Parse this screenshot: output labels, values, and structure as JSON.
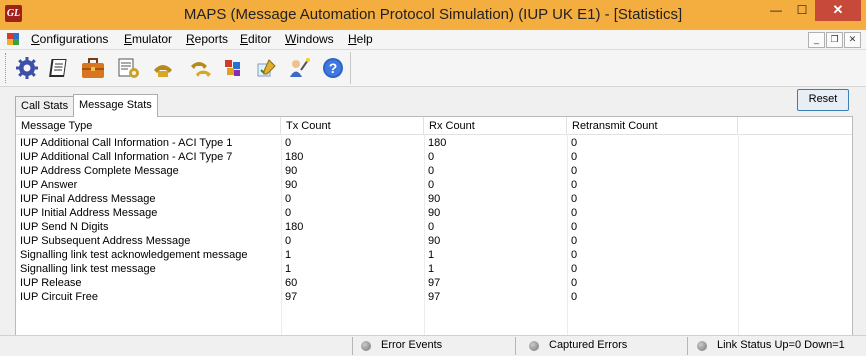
{
  "window": {
    "title": "MAPS (Message Automation Protocol Simulation)  (IUP UK E1) - [Statistics]",
    "icon_text": "GL",
    "minimize": "—",
    "maximize": "☐",
    "close": "✕"
  },
  "menu": {
    "items": [
      "Configurations",
      "Emulator",
      "Reports",
      "Editor",
      "Windows",
      "Help"
    ],
    "mdi_min": "_",
    "mdi_restore": "❐",
    "mdi_close": "✕"
  },
  "toolbar": {
    "icons": [
      "gear-icon",
      "notebook-icon",
      "briefcase-icon",
      "script-edit-icon",
      "phone-call-icon",
      "phone-transfer-icon",
      "color-blocks-icon",
      "pen-check-icon",
      "wizard-icon",
      "help-icon"
    ]
  },
  "tabs": [
    "Call Stats",
    "Message Stats"
  ],
  "active_tab": "Message Stats",
  "reset_label": "Reset",
  "table": {
    "columns": [
      "Message Type",
      "Tx Count",
      "Rx Count",
      "Retransmit Count"
    ],
    "rows": [
      [
        "IUP Additional Call Information - ACI Type 1",
        "0",
        "180",
        "0"
      ],
      [
        "IUP Additional Call Information - ACI Type 7",
        "180",
        "0",
        "0"
      ],
      [
        "IUP Address Complete Message",
        "90",
        "0",
        "0"
      ],
      [
        "IUP Answer",
        "90",
        "0",
        "0"
      ],
      [
        "IUP Final Address Message",
        "0",
        "90",
        "0"
      ],
      [
        "IUP Initial Address Message",
        "0",
        "90",
        "0"
      ],
      [
        "IUP Send N Digits",
        "180",
        "0",
        "0"
      ],
      [
        "IUP Subsequent Address Message",
        "0",
        "90",
        "0"
      ],
      [
        "Signalling link test acknowledgement message",
        "1",
        "1",
        "0"
      ],
      [
        "Signalling link test message",
        "1",
        "1",
        "0"
      ],
      [
        "IUP Release",
        "60",
        "97",
        "0"
      ],
      [
        "IUP Circuit Free",
        "97",
        "97",
        "0"
      ]
    ]
  },
  "status": {
    "error_events": "Error Events",
    "captured_errors": "Captured Errors",
    "link_status": "Link Status Up=0 Down=1"
  },
  "colors": {
    "titlebar": "#f4ad3f",
    "close_button": "#c7493a",
    "reset_border": "#3c7fb1"
  }
}
